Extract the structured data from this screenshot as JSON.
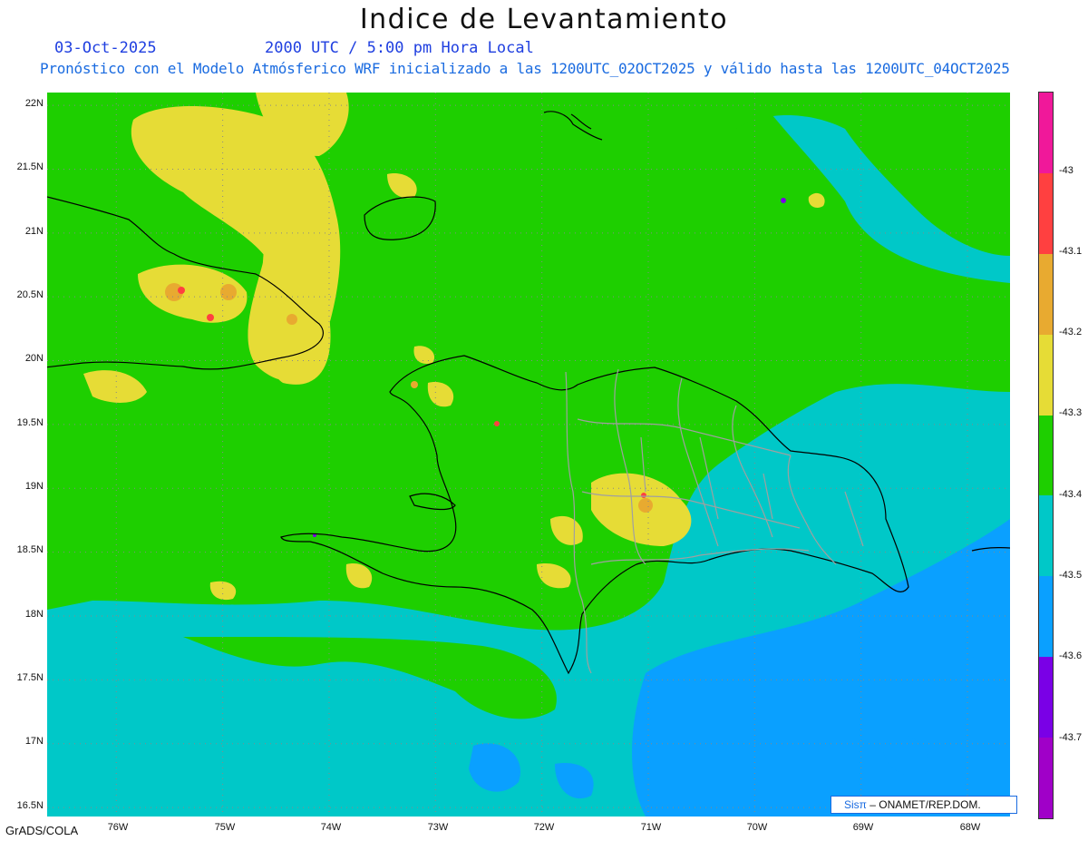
{
  "title": "Indice de Levantamiento",
  "date": "03-Oct-2025",
  "time": "2000 UTC / 5:00 pm Hora Local",
  "subtitle": "Pronóstico con el Modelo Atmósferico WRF inicializado a las 1200UTC_02OCT2025 y válido hasta las  1200UTC_04OCT2025",
  "axes": {
    "lat_labels": [
      "22N",
      "21.5N",
      "21N",
      "20.5N",
      "20N",
      "19.5N",
      "19N",
      "18.5N",
      "18N",
      "17.5N",
      "17N",
      "16.5N"
    ],
    "lat_values": [
      22,
      21.5,
      21,
      20.5,
      20,
      19.5,
      19,
      18.5,
      18,
      17.5,
      17,
      16.5
    ],
    "lon_labels": [
      "76W",
      "75W",
      "74W",
      "73W",
      "72W",
      "71W",
      "70W",
      "69W",
      "68W"
    ],
    "lon_values": [
      -76,
      -75,
      -74,
      -73,
      -72,
      -71,
      -70,
      -69,
      -68
    ],
    "extent": {
      "lon_min": -76.65,
      "lon_max": -67.6,
      "lat_min": 16.43,
      "lat_max": 22.1
    }
  },
  "colorbar": {
    "labels": [
      "-43",
      "-43.1",
      "-43.2",
      "-43.3",
      "-43.4",
      "-43.5",
      "-43.6",
      "-43.7"
    ],
    "colors": [
      "#f0189a",
      "#ff4040",
      "#e8aa30",
      "#e6dc36",
      "#1ecf00",
      "#00c8c8",
      "#0aa0ff",
      "#7a00e6",
      "#a000c8"
    ]
  },
  "credit": {
    "brand": "Sisπ",
    "org": " – ONAMET/REP.DOM."
  },
  "footer": "GrADS/COLA"
}
